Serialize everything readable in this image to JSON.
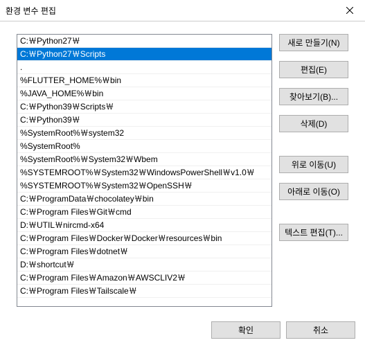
{
  "titlebar": {
    "title": "환경 변수 편집"
  },
  "list": {
    "selected_index": 1,
    "items": [
      "C:￦Python27￦",
      "C:￦Python27￦Scripts",
      ".",
      "%FLUTTER_HOME%￦bin",
      "%JAVA_HOME%￦bin",
      "C:￦Python39￦Scripts￦",
      "C:￦Python39￦",
      "%SystemRoot%￦system32",
      "%SystemRoot%",
      "%SystemRoot%￦System32￦Wbem",
      "%SYSTEMROOT%￦System32￦WindowsPowerShell￦v1.0￦",
      "%SYSTEMROOT%￦System32￦OpenSSH￦",
      "C:￦ProgramData￦chocolatey￦bin",
      "C:￦Program Files￦Git￦cmd",
      "D:￦UTIL￦nircmd-x64",
      "C:￦Program Files￦Docker￦Docker￦resources￦bin",
      "C:￦Program Files￦dotnet￦",
      "D:￦shortcut￦",
      "C:￦Program Files￦Amazon￦AWSCLIV2￦",
      "C:￦Program Files￦Tailscale￦"
    ]
  },
  "buttons": {
    "new": "새로 만들기(N)",
    "edit": "편집(E)",
    "browse": "찾아보기(B)...",
    "delete": "삭제(D)",
    "move_up": "위로 이동(U)",
    "move_down": "아래로 이동(O)",
    "edit_text": "텍스트 편집(T)...",
    "ok": "확인",
    "cancel": "취소"
  }
}
